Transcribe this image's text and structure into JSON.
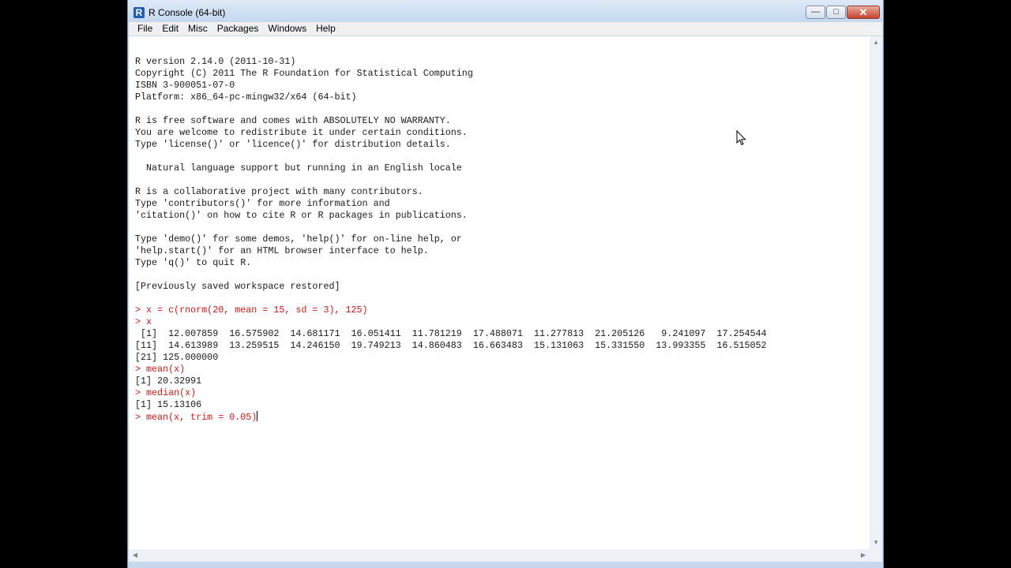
{
  "window": {
    "title": "R Console (64-bit)",
    "icon": "R"
  },
  "window_controls": {
    "minimize": "—",
    "maximize": "□",
    "close": "✕"
  },
  "menu": [
    "File",
    "Edit",
    "Misc",
    "Packages",
    "Windows",
    "Help"
  ],
  "console_lines": [
    {
      "text": "R version 2.14.0 (2011-10-31)",
      "type": "output"
    },
    {
      "text": "Copyright (C) 2011 The R Foundation for Statistical Computing",
      "type": "output"
    },
    {
      "text": "ISBN 3-900051-07-0",
      "type": "output"
    },
    {
      "text": "Platform: x86_64-pc-mingw32/x64 (64-bit)",
      "type": "output"
    },
    {
      "text": "",
      "type": "output"
    },
    {
      "text": "R is free software and comes with ABSOLUTELY NO WARRANTY.",
      "type": "output"
    },
    {
      "text": "You are welcome to redistribute it under certain conditions.",
      "type": "output"
    },
    {
      "text": "Type 'license()' or 'licence()' for distribution details.",
      "type": "output"
    },
    {
      "text": "",
      "type": "output"
    },
    {
      "text": "  Natural language support but running in an English locale",
      "type": "output"
    },
    {
      "text": "",
      "type": "output"
    },
    {
      "text": "R is a collaborative project with many contributors.",
      "type": "output"
    },
    {
      "text": "Type 'contributors()' for more information and",
      "type": "output"
    },
    {
      "text": "'citation()' on how to cite R or R packages in publications.",
      "type": "output"
    },
    {
      "text": "",
      "type": "output"
    },
    {
      "text": "Type 'demo()' for some demos, 'help()' for on-line help, or",
      "type": "output"
    },
    {
      "text": "'help.start()' for an HTML browser interface to help.",
      "type": "output"
    },
    {
      "text": "Type 'q()' to quit R.",
      "type": "output"
    },
    {
      "text": "",
      "type": "output"
    },
    {
      "text": "[Previously saved workspace restored]",
      "type": "output"
    },
    {
      "text": "",
      "type": "output"
    },
    {
      "text": "> x = c(rnorm(20, mean = 15, sd = 3), 125)",
      "type": "input"
    },
    {
      "text": "> x",
      "type": "input"
    },
    {
      "text": " [1]  12.007859  16.575902  14.681171  16.051411  11.781219  17.488071  11.277813  21.205126   9.241097  17.254544",
      "type": "output"
    },
    {
      "text": "[11]  14.613989  13.259515  14.246150  19.749213  14.860483  16.663483  15.131063  15.331550  13.993355  16.515052",
      "type": "output"
    },
    {
      "text": "[21] 125.000000",
      "type": "output"
    },
    {
      "text": "> mean(x)",
      "type": "input"
    },
    {
      "text": "[1] 20.32991",
      "type": "output"
    },
    {
      "text": "> median(x)",
      "type": "input"
    },
    {
      "text": "[1] 15.13106",
      "type": "output"
    },
    {
      "text": "> mean(x, trim = 0.05)",
      "type": "input-current"
    }
  ]
}
